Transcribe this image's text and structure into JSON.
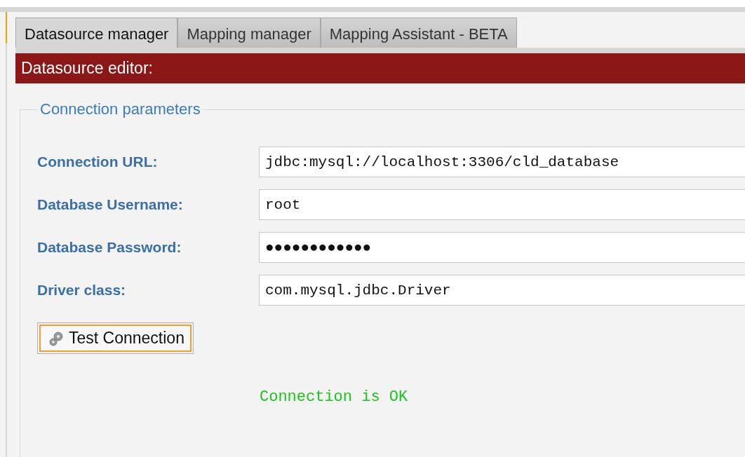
{
  "tabs": [
    {
      "label": "Datasource manager",
      "selected": true
    },
    {
      "label": "Mapping manager",
      "selected": false
    },
    {
      "label": "Mapping Assistant - BETA",
      "selected": false
    }
  ],
  "editor_title": "Datasource editor:",
  "group": {
    "legend": "Connection parameters",
    "fields": [
      {
        "label": "Connection URL:",
        "value": "jdbc:mysql://localhost:3306/cld_database"
      },
      {
        "label": "Database Username:",
        "value": "root"
      },
      {
        "label": "Database Password:",
        "value": "●●●●●●●●●●●●"
      },
      {
        "label": "Driver class:",
        "value": "com.mysql.jdbc.Driver"
      }
    ],
    "button": "Test Connection",
    "status": "Connection is OK"
  }
}
